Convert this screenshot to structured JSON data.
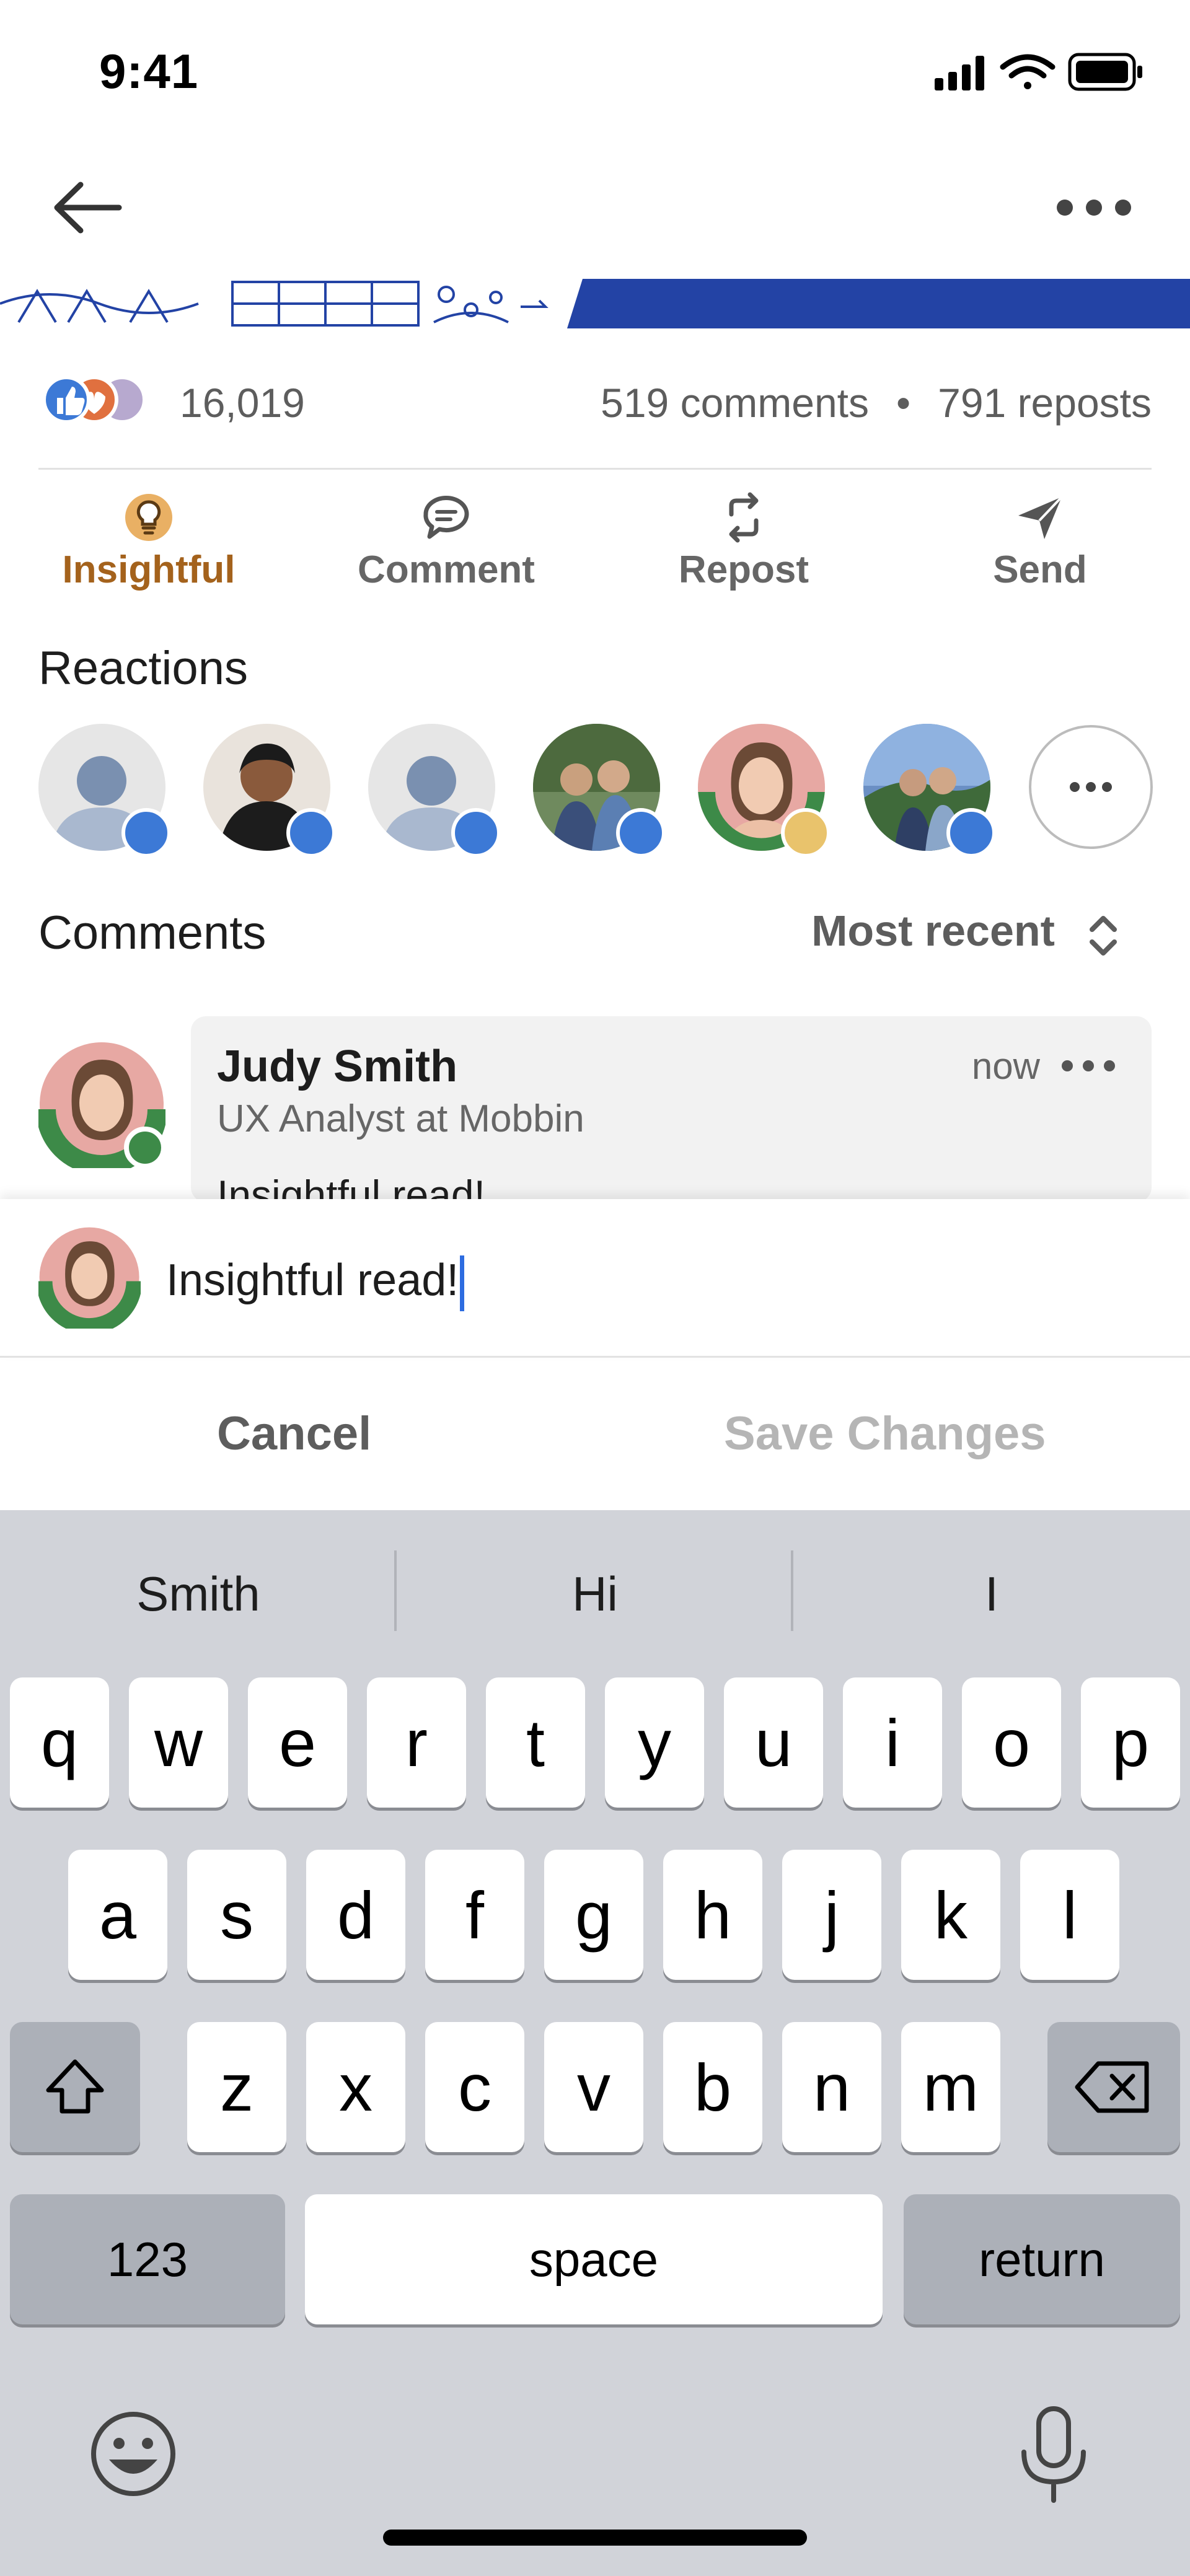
{
  "status_bar": {
    "time": "9:41"
  },
  "post_stats": {
    "reaction_count": "16,019",
    "comments": "519 comments",
    "separator": "•",
    "reposts": "791 reposts"
  },
  "actions": [
    {
      "label": "Insightful",
      "icon": "lightbulb-icon",
      "active": true
    },
    {
      "label": "Comment",
      "icon": "comment-icon"
    },
    {
      "label": "Repost",
      "icon": "repost-icon"
    },
    {
      "label": "Send",
      "icon": "send-icon"
    }
  ],
  "reactions": {
    "title": "Reactions",
    "people": [
      {
        "avatar": "placeholder",
        "reaction": "like"
      },
      {
        "avatar": "photo",
        "reaction": "like"
      },
      {
        "avatar": "placeholder",
        "reaction": "like"
      },
      {
        "avatar": "photo",
        "reaction": "like"
      },
      {
        "avatar": "photo",
        "reaction": "insightful"
      },
      {
        "avatar": "photo",
        "reaction": "like"
      }
    ]
  },
  "comments_section": {
    "title": "Comments",
    "sort": "Most recent",
    "items": [
      {
        "author": "Judy Smith",
        "headline": "UX Analyst at Mobbin",
        "time": "now",
        "text": "Insightful read!"
      }
    ]
  },
  "composer": {
    "value": "Insightful read!",
    "cancel": "Cancel",
    "save": "Save Changes"
  },
  "keyboard": {
    "suggestions": [
      "Smith",
      "Hi",
      "I"
    ],
    "row1": [
      "q",
      "w",
      "e",
      "r",
      "t",
      "y",
      "u",
      "i",
      "o",
      "p"
    ],
    "row2": [
      "a",
      "s",
      "d",
      "f",
      "g",
      "h",
      "j",
      "k",
      "l"
    ],
    "row3": [
      "z",
      "x",
      "c",
      "v",
      "b",
      "n",
      "m"
    ],
    "numbers": "123",
    "space": "space",
    "return": "return"
  },
  "colors": {
    "insightful": "#a4621c",
    "like_badge": "#3c79d6",
    "banner_blue": "#2343a5",
    "caret": "#2d6ce0"
  }
}
